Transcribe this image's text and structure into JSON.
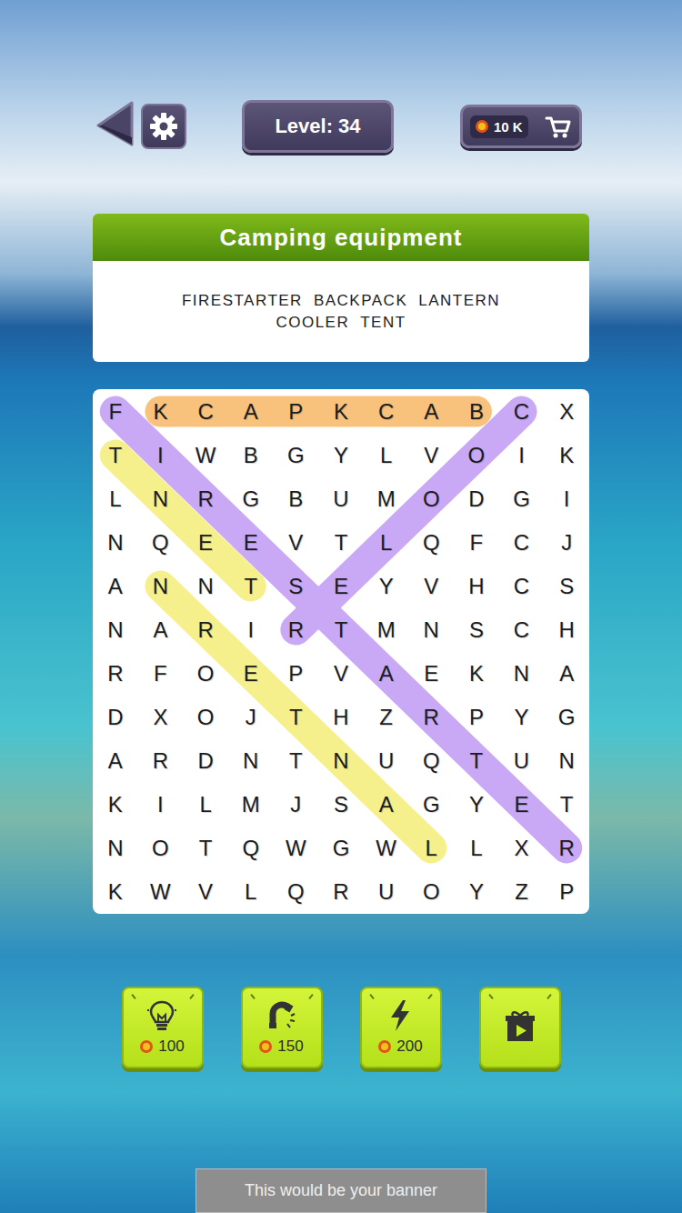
{
  "level": "Level: 34",
  "coins": "10 K",
  "category": "Camping equipment",
  "words": [
    "FIRESTARTER",
    "BACKPACK",
    "LANTERN",
    "COOLER",
    "TENT"
  ],
  "grid": [
    [
      "F",
      "K",
      "C",
      "A",
      "P",
      "K",
      "C",
      "A",
      "B",
      "C",
      "X"
    ],
    [
      "T",
      "I",
      "W",
      "B",
      "G",
      "Y",
      "L",
      "V",
      "O",
      "I",
      "K"
    ],
    [
      "L",
      "N",
      "R",
      "G",
      "B",
      "U",
      "M",
      "O",
      "D",
      "G",
      "I"
    ],
    [
      "N",
      "Q",
      "E",
      "E",
      "V",
      "T",
      "L",
      "Q",
      "F",
      "C",
      "J"
    ],
    [
      "A",
      "N",
      "N",
      "T",
      "S",
      "E",
      "Y",
      "V",
      "H",
      "C",
      "S"
    ],
    [
      "N",
      "A",
      "R",
      "I",
      "R",
      "T",
      "M",
      "N",
      "S",
      "C",
      "H"
    ],
    [
      "R",
      "F",
      "O",
      "E",
      "P",
      "V",
      "A",
      "E",
      "K",
      "N",
      "A"
    ],
    [
      "D",
      "X",
      "O",
      "J",
      "T",
      "H",
      "Z",
      "R",
      "P",
      "Y",
      "G"
    ],
    [
      "A",
      "R",
      "D",
      "N",
      "T",
      "N",
      "U",
      "Q",
      "T",
      "U",
      "N"
    ],
    [
      "K",
      "I",
      "L",
      "M",
      "J",
      "S",
      "A",
      "G",
      "Y",
      "E",
      "T"
    ],
    [
      "N",
      "O",
      "T",
      "Q",
      "W",
      "G",
      "W",
      "L",
      "L",
      "X",
      "R"
    ],
    [
      "K",
      "W",
      "V",
      "L",
      "Q",
      "R",
      "U",
      "O",
      "Y",
      "Z",
      "P"
    ]
  ],
  "highlights": [
    {
      "start": [
        0,
        8
      ],
      "end": [
        0,
        1
      ],
      "color": "#f9c27c"
    },
    {
      "start": [
        0,
        0
      ],
      "end": [
        10,
        10
      ],
      "color": "#c9a9f6"
    },
    {
      "start": [
        0,
        9
      ],
      "end": [
        5,
        4
      ],
      "color": "#c9a9f6"
    },
    {
      "start": [
        4,
        3
      ],
      "end": [
        1,
        0
      ],
      "color": "#f6f08c"
    },
    {
      "start": [
        10,
        7
      ],
      "end": [
        4,
        1
      ],
      "color": "#f6f08c"
    }
  ],
  "tools": [
    {
      "kind": "hint",
      "price": "100"
    },
    {
      "kind": "magnet",
      "price": "150"
    },
    {
      "kind": "lightning",
      "price": "200"
    },
    {
      "kind": "video",
      "price": null
    }
  ],
  "banner": "This would be your banner"
}
